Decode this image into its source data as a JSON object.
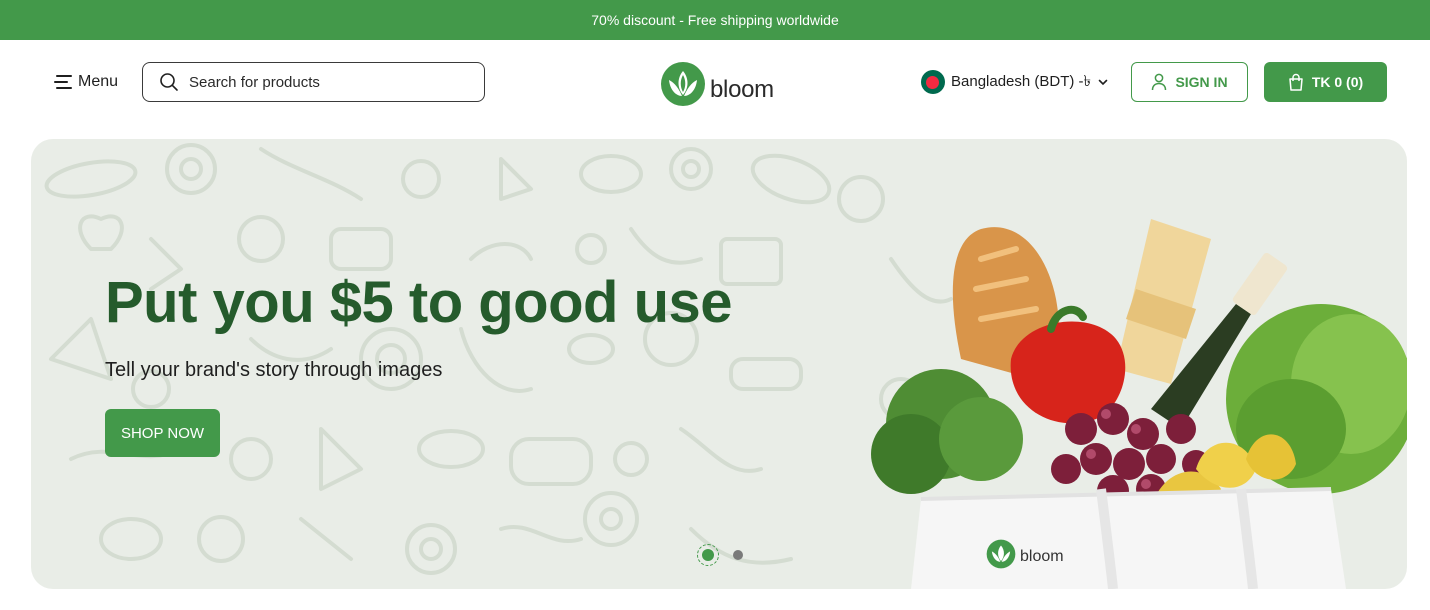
{
  "announcement": "70% discount - Free shipping worldwide",
  "header": {
    "menu_label": "Menu",
    "search_placeholder": "Search for products",
    "logo_text": "bloom",
    "country_label": "Bangladesh (BDT) -৳",
    "signin_label": "SIGN IN",
    "cart_label": "TK 0 (0)"
  },
  "hero": {
    "title": "Put you $5 to good use",
    "subtitle": "Tell your brand's story through images",
    "cta_label": "SHOP NOW",
    "bag_logo_text": "bloom",
    "slides": {
      "total": 2,
      "active": 1
    }
  },
  "colors": {
    "brand_green": "#43994a",
    "title_green": "#255b2c",
    "hero_bg": "#e9ede7"
  },
  "icons": [
    "menu-icon",
    "search-icon",
    "logo-lotus-icon",
    "flag-icon",
    "chevron-down-icon",
    "user-icon",
    "shopping-bag-icon"
  ]
}
